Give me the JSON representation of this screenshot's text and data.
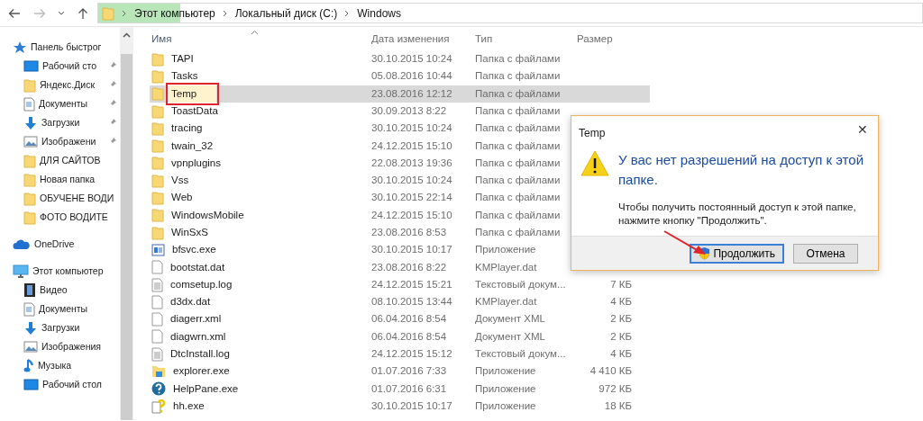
{
  "address": {
    "level": 0.1,
    "crumbs": [
      "Этот компьютер",
      "Локальный диск (C:)",
      "Windows"
    ]
  },
  "nav": [
    {
      "label": "Панель быстрог",
      "kind": "star",
      "pinned": false,
      "children": [
        {
          "label": "Рабочий сто",
          "kind": "desktop",
          "pinned": true
        },
        {
          "label": "Яндекс.Диск",
          "kind": "folder",
          "pinned": true
        },
        {
          "label": "Документы",
          "kind": "docs",
          "pinned": true
        },
        {
          "label": "Загрузки",
          "kind": "download",
          "pinned": true
        },
        {
          "label": "Изображени",
          "kind": "images",
          "pinned": true
        },
        {
          "label": "ДЛЯ САЙТОВ",
          "kind": "folder",
          "pinned": false
        },
        {
          "label": "Новая папка",
          "kind": "folder",
          "pinned": false
        },
        {
          "label": "ОБУЧЕНЕ ВОДИ",
          "kind": "folder",
          "pinned": false
        },
        {
          "label": "ФОТО ВОДИТЕ",
          "kind": "folder",
          "pinned": false
        }
      ]
    },
    {
      "label": "OneDrive",
      "kind": "cloud",
      "pinned": false
    },
    {
      "label": "Этот компьютер",
      "kind": "pc",
      "pinned": false,
      "children": [
        {
          "label": "Видео",
          "kind": "video",
          "pinned": false
        },
        {
          "label": "Документы",
          "kind": "docs",
          "pinned": false
        },
        {
          "label": "Загрузки",
          "kind": "download",
          "pinned": false
        },
        {
          "label": "Изображения",
          "kind": "images",
          "pinned": false
        },
        {
          "label": "Музыка",
          "kind": "music",
          "pinned": false
        },
        {
          "label": "Рабочий стол",
          "kind": "desktop",
          "pinned": false
        }
      ]
    }
  ],
  "table": {
    "columns": [
      "Имя",
      "Дата изменения",
      "Тип",
      "Размер"
    ],
    "rows": [
      {
        "kind": "folder",
        "name": "TAPI",
        "date": "30.10.2015 10:24",
        "type": "Папка с файлами",
        "selected": false,
        "marked": false
      },
      {
        "kind": "folder",
        "name": "Tasks",
        "date": "05.08.2016 10:44",
        "type": "Папка с файлами",
        "selected": false,
        "marked": false
      },
      {
        "kind": "folder",
        "name": "Temp",
        "date": "23.08.2016 12:12",
        "type": "Папка с файлами",
        "selected": true,
        "marked": true
      },
      {
        "kind": "folder",
        "name": "ToastData",
        "date": "30.09.2013 8:22",
        "type": "Папка с файлами",
        "selected": false,
        "marked": false
      },
      {
        "kind": "folder",
        "name": "tracing",
        "date": "30.10.2015 10:24",
        "type": "Папка с файлами",
        "selected": false,
        "marked": false
      },
      {
        "kind": "folder",
        "name": "twain_32",
        "date": "24.12.2015 15:10",
        "type": "Папка с файлами",
        "selected": false,
        "marked": false
      },
      {
        "kind": "folder",
        "name": "vpnplugins",
        "date": "22.08.2013 19:36",
        "type": "Папка с файлами",
        "selected": false,
        "marked": false
      },
      {
        "kind": "folder",
        "name": "Vss",
        "date": "30.10.2015 10:24",
        "type": "Папка с файлами",
        "selected": false,
        "marked": false
      },
      {
        "kind": "folder",
        "name": "Web",
        "date": "30.10.2015 22:14",
        "type": "Папка с файлами",
        "selected": false,
        "marked": false
      },
      {
        "kind": "folder",
        "name": "WindowsMobile",
        "date": "24.12.2015 15:10",
        "type": "Папка с файлами",
        "selected": false,
        "marked": false
      },
      {
        "kind": "folder",
        "name": "WinSxS",
        "date": "23.08.2016 8:53",
        "type": "Папка с файлами",
        "selected": false,
        "marked": false
      },
      {
        "kind": "app",
        "name": "bfsvc.exe",
        "date": "30.10.2015 10:17",
        "type": "Приложение",
        "selected": false,
        "marked": false
      },
      {
        "kind": "file",
        "name": "bootstat.dat",
        "date": "23.08.2016 8:22",
        "type": "KMPlayer.dat",
        "selected": false,
        "marked": false
      },
      {
        "kind": "text",
        "name": "comsetup.log",
        "date": "24.12.2015 15:21",
        "type": "Текстовый докум...",
        "size": "7 КБ",
        "selected": false,
        "marked": false
      },
      {
        "kind": "file",
        "name": "d3dx.dat",
        "date": "08.10.2015 13:44",
        "type": "KMPlayer.dat",
        "size": "4 КБ",
        "selected": false,
        "marked": false
      },
      {
        "kind": "file",
        "name": "diagerr.xml",
        "date": "06.04.2016 8:54",
        "type": "Документ XML",
        "size": "2 КБ",
        "selected": false,
        "marked": false
      },
      {
        "kind": "file",
        "name": "diagwrn.xml",
        "date": "06.04.2016 8:54",
        "type": "Документ XML",
        "size": "2 КБ",
        "selected": false,
        "marked": false
      },
      {
        "kind": "text",
        "name": "DtcInstall.log",
        "date": "24.12.2015 15:12",
        "type": "Текстовый докум...",
        "size": "4 КБ",
        "selected": false,
        "marked": false
      },
      {
        "kind": "explorer",
        "name": "explorer.exe",
        "date": "01.07.2016 7:33",
        "type": "Приложение",
        "size": "4 410 КБ",
        "selected": false,
        "marked": false
      },
      {
        "kind": "help",
        "name": "HelpPane.exe",
        "date": "01.07.2016 6:31",
        "type": "Приложение",
        "size": "972 КБ",
        "selected": false,
        "marked": false
      },
      {
        "kind": "hh",
        "name": "hh.exe",
        "date": "30.10.2015 10:17",
        "type": "Приложение",
        "size": "18 КБ",
        "selected": false,
        "marked": false
      }
    ]
  },
  "dialog": {
    "title": "Temp",
    "close": "✕",
    "heading": "У вас нет разрешений на доступ к этой папке.",
    "message": "Чтобы получить постоянный доступ к этой папке, нажмите кнопку \"Продолжить\".",
    "buttons": [
      {
        "label": "Продолжить",
        "shield": true,
        "selected": true
      },
      {
        "label": "Отмена",
        "shield": false,
        "selected": false
      }
    ],
    "arrow_to_button": true
  }
}
